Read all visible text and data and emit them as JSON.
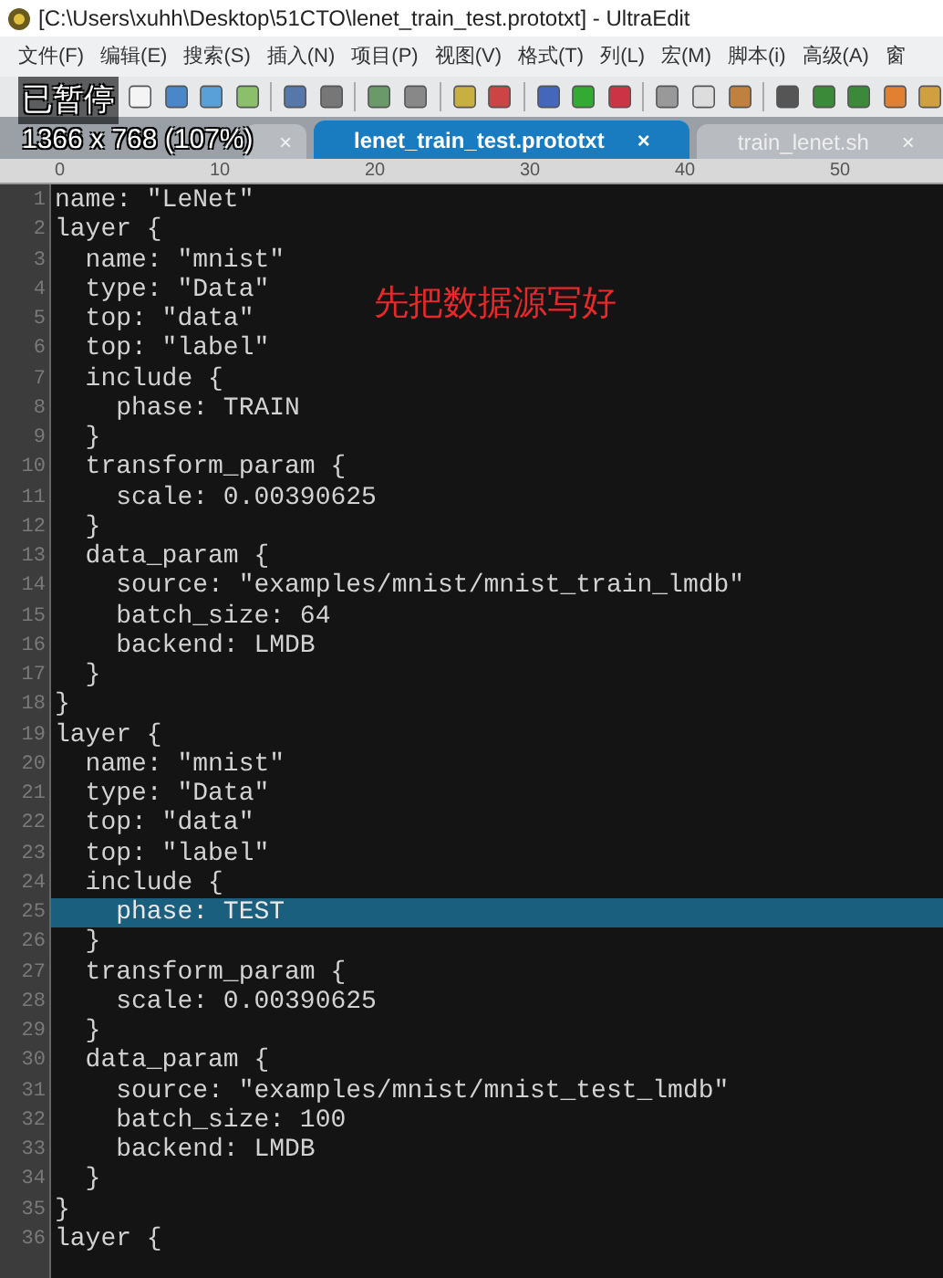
{
  "window": {
    "title": "[C:\\Users\\xuhh\\Desktop\\51CTO\\lenet_train_test.prototxt] - UltraEdit"
  },
  "menu": [
    "文件(F)",
    "编辑(E)",
    "搜索(S)",
    "插入(N)",
    "项目(P)",
    "视图(V)",
    "格式(T)",
    "列(L)",
    "宏(M)",
    "脚本(i)",
    "高级(A)",
    "窗"
  ],
  "overlay": {
    "status": "已暂停",
    "resolution": "1366 x 768 (107%)"
  },
  "tabs": [
    {
      "close": "×",
      "selected": false
    },
    {
      "label": "lenet_train_test.prototxt",
      "close": "×",
      "selected": true
    },
    {
      "label": "train_lenet.sh",
      "close": "×",
      "selected": false
    }
  ],
  "ruler": [
    "0",
    "10",
    "20",
    "30",
    "40",
    "50"
  ],
  "annotation": "先把数据源写好",
  "lines": [
    {
      "number": "1",
      "text": "name: \"LeNet\"",
      "selected": false
    },
    {
      "number": "2",
      "text": "layer {",
      "selected": false
    },
    {
      "number": "3",
      "text": "  name: \"mnist\"",
      "selected": false
    },
    {
      "number": "4",
      "text": "  type: \"Data\"",
      "selected": false
    },
    {
      "number": "5",
      "text": "  top: \"data\"",
      "selected": false
    },
    {
      "number": "6",
      "text": "  top: \"label\"",
      "selected": false
    },
    {
      "number": "7",
      "text": "  include {",
      "selected": false
    },
    {
      "number": "8",
      "text": "    phase: TRAIN",
      "selected": false
    },
    {
      "number": "9",
      "text": "  }",
      "selected": false
    },
    {
      "number": "10",
      "text": "  transform_param {",
      "selected": false
    },
    {
      "number": "11",
      "text": "    scale: 0.00390625",
      "selected": false
    },
    {
      "number": "12",
      "text": "  }",
      "selected": false
    },
    {
      "number": "13",
      "text": "  data_param {",
      "selected": false
    },
    {
      "number": "14",
      "text": "    source: \"examples/mnist/mnist_train_lmdb\"",
      "selected": false
    },
    {
      "number": "15",
      "text": "    batch_size: 64",
      "selected": false
    },
    {
      "number": "16",
      "text": "    backend: LMDB",
      "selected": false
    },
    {
      "number": "17",
      "text": "  }",
      "selected": false
    },
    {
      "number": "18",
      "text": "}",
      "selected": false
    },
    {
      "number": "19",
      "text": "layer {",
      "selected": false
    },
    {
      "number": "20",
      "text": "  name: \"mnist\"",
      "selected": false
    },
    {
      "number": "21",
      "text": "  type: \"Data\"",
      "selected": false
    },
    {
      "number": "22",
      "text": "  top: \"data\"",
      "selected": false
    },
    {
      "number": "23",
      "text": "  top: \"label\"",
      "selected": false
    },
    {
      "number": "24",
      "text": "  include {",
      "selected": false
    },
    {
      "number": "25",
      "text": "    phase: TEST",
      "selected": true
    },
    {
      "number": "26",
      "text": "  }",
      "selected": false
    },
    {
      "number": "27",
      "text": "  transform_param {",
      "selected": false
    },
    {
      "number": "28",
      "text": "    scale: 0.00390625",
      "selected": false
    },
    {
      "number": "29",
      "text": "  }",
      "selected": false
    },
    {
      "number": "30",
      "text": "  data_param {",
      "selected": false
    },
    {
      "number": "31",
      "text": "    source: \"examples/mnist/mnist_test_lmdb\"",
      "selected": false
    },
    {
      "number": "32",
      "text": "    batch_size: 100",
      "selected": false
    },
    {
      "number": "33",
      "text": "    backend: LMDB",
      "selected": false
    },
    {
      "number": "34",
      "text": "  }",
      "selected": false
    },
    {
      "number": "35",
      "text": "}",
      "selected": false
    },
    {
      "number": "36",
      "text": "layer {",
      "selected": false
    }
  ]
}
